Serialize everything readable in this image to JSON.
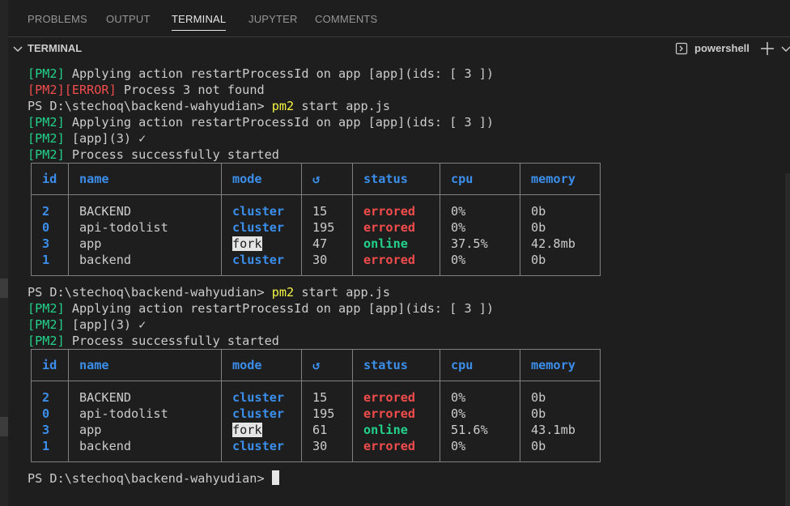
{
  "tabs": [
    {
      "label": "PROBLEMS",
      "active": false
    },
    {
      "label": "OUTPUT",
      "active": false
    },
    {
      "label": "TERMINAL",
      "active": true
    },
    {
      "label": "JUPYTER",
      "active": false
    },
    {
      "label": "COMMENTS",
      "active": false
    }
  ],
  "panel": {
    "title": "TERMINAL",
    "shell": "powershell"
  },
  "terminal": {
    "line1": {
      "tag": "[PM2]",
      "text": " Applying action restartProcessId on app [app](ids: [ 3 ])"
    },
    "line2": {
      "tag": "[PM2][ERROR]",
      "text": " Process 3 not found"
    },
    "prompt": "PS D:\\stechoq\\backend-wahyudian> ",
    "cmd": "pm2",
    "cmd_args": " start app.js",
    "apply_line": {
      "tag": "[PM2]",
      "text": " Applying action restartProcessId on app [app](ids: [ 3 ])"
    },
    "app_line": {
      "tag": "[PM2]",
      "text": " [app](3) ✓"
    },
    "started_line": {
      "tag": "[PM2]",
      "text": " Process successfully started"
    }
  },
  "table": {
    "headers": [
      "id",
      "name",
      "mode",
      "↺",
      "status",
      "cpu",
      "memory"
    ]
  },
  "tables": [
    {
      "rows": [
        {
          "id": "2",
          "name": "BACKEND",
          "mode": "cluster",
          "restarts": "15",
          "status": "errored",
          "cpu": "0%",
          "memory": "0b"
        },
        {
          "id": "0",
          "name": "api-todolist",
          "mode": "cluster",
          "restarts": "195",
          "status": "errored",
          "cpu": "0%",
          "memory": "0b"
        },
        {
          "id": "3",
          "name": "app",
          "mode": "fork",
          "restarts": "47",
          "status": "online",
          "cpu": "37.5%",
          "memory": "42.8mb"
        },
        {
          "id": "1",
          "name": "backend",
          "mode": "cluster",
          "restarts": "30",
          "status": "errored",
          "cpu": "0%",
          "memory": "0b"
        }
      ]
    },
    {
      "rows": [
        {
          "id": "2",
          "name": "BACKEND",
          "mode": "cluster",
          "restarts": "15",
          "status": "errored",
          "cpu": "0%",
          "memory": "0b"
        },
        {
          "id": "0",
          "name": "api-todolist",
          "mode": "cluster",
          "restarts": "195",
          "status": "errored",
          "cpu": "0%",
          "memory": "0b"
        },
        {
          "id": "3",
          "name": "app",
          "mode": "fork",
          "restarts": "61",
          "status": "online",
          "cpu": "51.6%",
          "memory": "43.1mb"
        },
        {
          "id": "1",
          "name": "backend",
          "mode": "cluster",
          "restarts": "30",
          "status": "errored",
          "cpu": "0%",
          "memory": "0b"
        }
      ]
    }
  ],
  "colors": {
    "pm2_tag": "#23d18b",
    "error": "#f14c4c",
    "command": "#f5f543",
    "header": "#3b8eea"
  }
}
